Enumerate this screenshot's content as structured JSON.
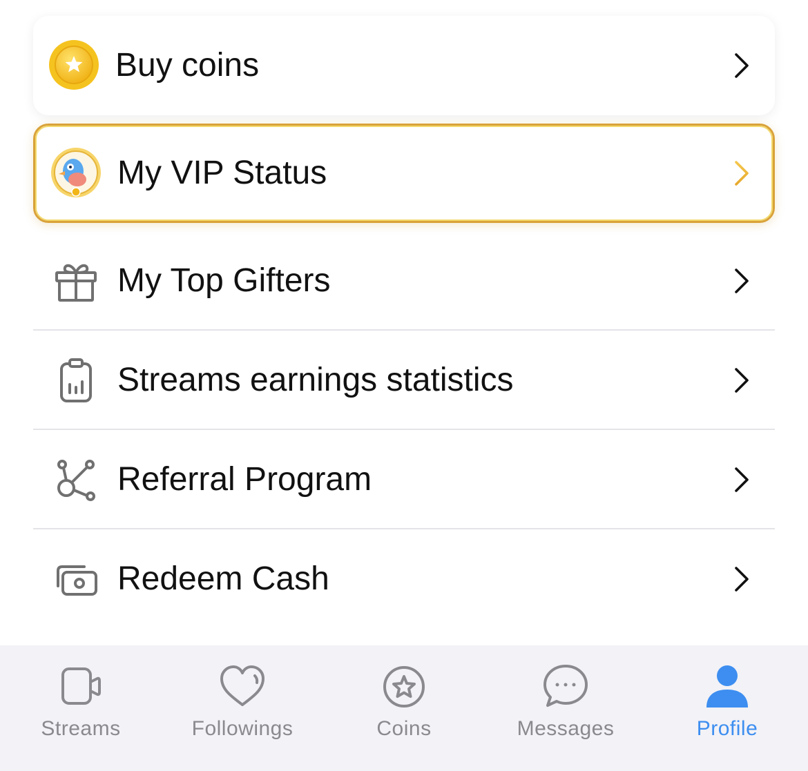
{
  "menu": {
    "buy_coins": "Buy coins",
    "vip_status": "My VIP Status",
    "top_gifters": "My Top Gifters",
    "earnings_stats": "Streams earnings statistics",
    "referral": "Referral Program",
    "redeem_cash": "Redeem Cash"
  },
  "tabs": [
    {
      "label": "Streams",
      "icon": "video-camera-icon"
    },
    {
      "label": "Followings",
      "icon": "heart-icon"
    },
    {
      "label": "Coins",
      "icon": "star-circle-icon"
    },
    {
      "label": "Messages",
      "icon": "chat-bubble-icon"
    },
    {
      "label": "Profile",
      "icon": "person-icon",
      "active": true
    }
  ],
  "colors": {
    "accent": "#3d8ef0",
    "vip_gold": "#d9a23a",
    "coin_gold": "#f2b619",
    "inactive": "#8a8a8e"
  }
}
